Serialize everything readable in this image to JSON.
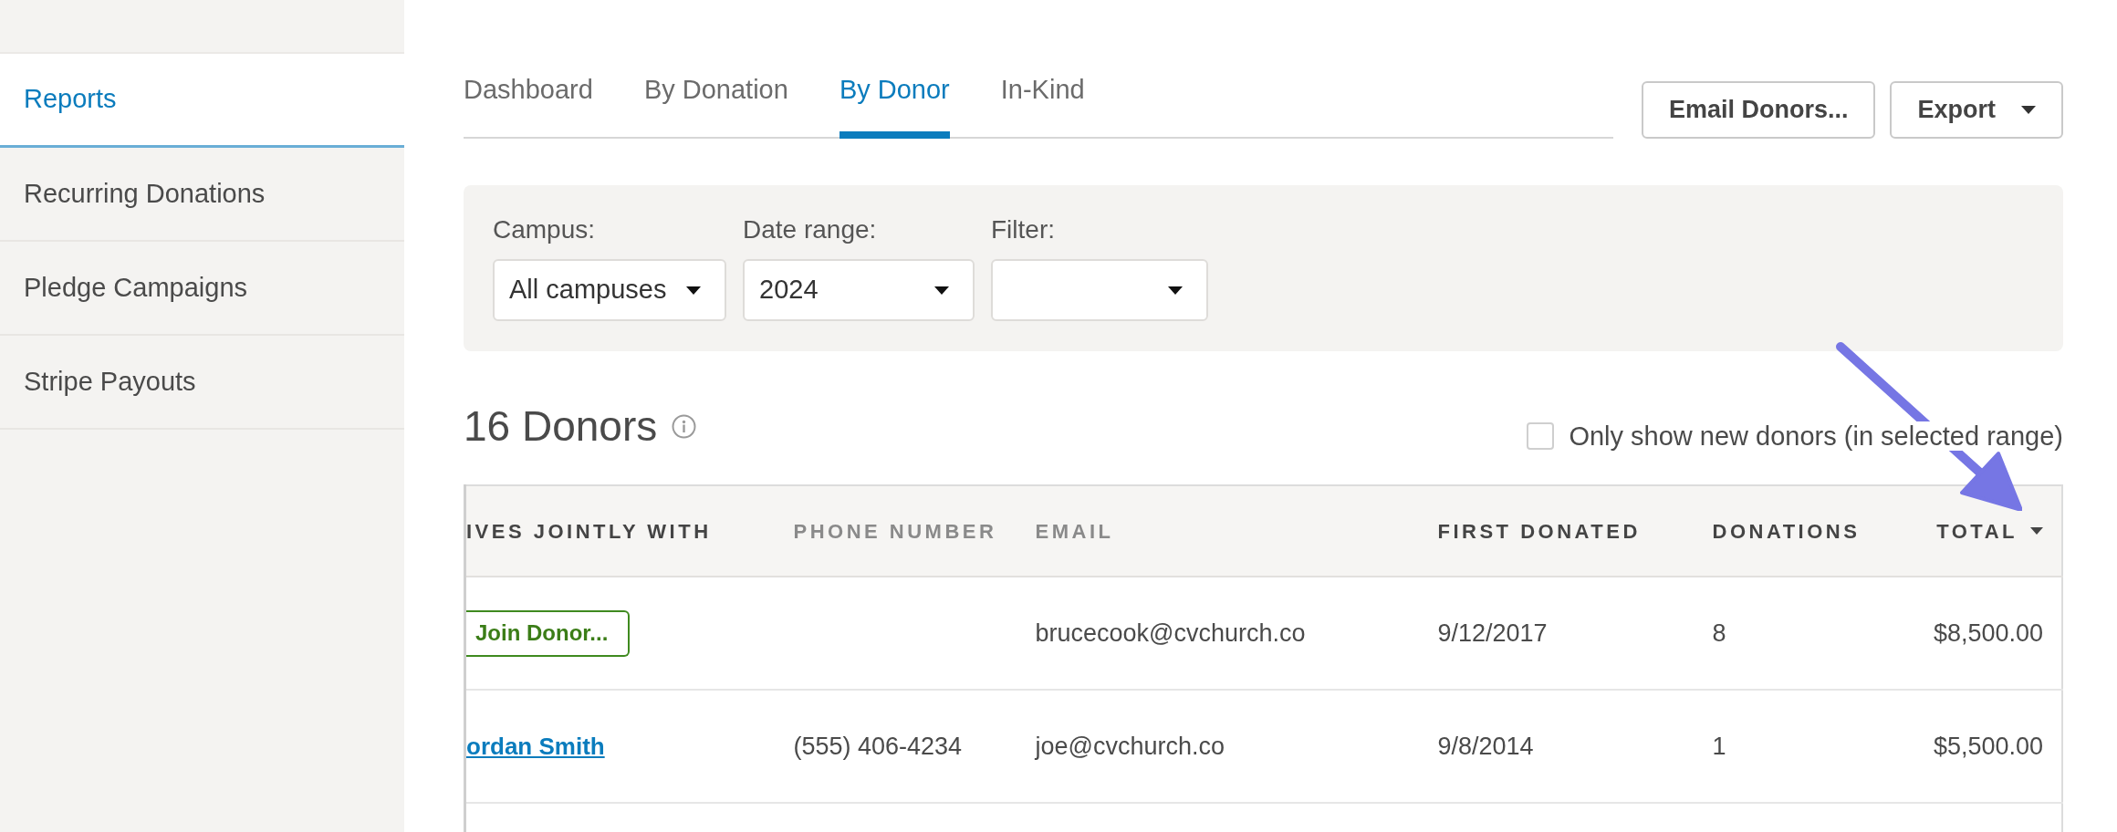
{
  "sidebar": {
    "items": [
      {
        "label": "Reports",
        "selected": true
      },
      {
        "label": "Recurring Donations",
        "selected": false
      },
      {
        "label": "Pledge Campaigns",
        "selected": false
      },
      {
        "label": "Stripe Payouts",
        "selected": false
      }
    ]
  },
  "tabs": [
    {
      "label": "Dashboard",
      "selected": false
    },
    {
      "label": "By Donation",
      "selected": false
    },
    {
      "label": "By Donor",
      "selected": true
    },
    {
      "label": "In-Kind",
      "selected": false
    }
  ],
  "email_button": {
    "label": "Email Donors..."
  },
  "export_button": {
    "label": "Export"
  },
  "filters": [
    {
      "label": "Campus:",
      "value": "All campuses"
    },
    {
      "label": "Date range:",
      "value": "2024"
    },
    {
      "label": "Filter:"
    }
  ],
  "heading": {
    "title": "16 Donors"
  },
  "new_donors_checkbox": {
    "label": "Only show new donors (in selected range)",
    "checked": false
  },
  "table": {
    "columns": [
      {
        "label": "IVES JOINTLY WITH",
        "sortable": true,
        "sorted": false
      },
      {
        "label": "PHONE NUMBER",
        "sortable": false,
        "sorted": false
      },
      {
        "label": "EMAIL",
        "sortable": false,
        "sorted": false
      },
      {
        "label": "FIRST DONATED",
        "sortable": true,
        "sorted": false
      },
      {
        "label": "DONATIONS",
        "sortable": true,
        "sorted": false
      },
      {
        "label": "TOTAL",
        "sortable": true,
        "sorted": true
      }
    ],
    "rows": [
      {
        "cells": [
          {
            "kind": "button",
            "text": "Join Donor..."
          },
          {
            "kind": "empty"
          },
          {
            "kind": "text",
            "text": "brucecook@cvchurch.co"
          },
          {
            "kind": "text",
            "text": "9/12/2017"
          },
          {
            "kind": "text",
            "text": "8"
          },
          {
            "kind": "text",
            "text": "$8,500.00"
          }
        ]
      },
      {
        "cells": [
          {
            "kind": "link",
            "text": "ordan Smith"
          },
          {
            "kind": "text",
            "text": "(555) 406-4234"
          },
          {
            "kind": "text",
            "text": "joe@cvchurch.co"
          },
          {
            "kind": "text",
            "text": "9/8/2014"
          },
          {
            "kind": "text",
            "text": "1"
          },
          {
            "kind": "text",
            "text": "$5,500.00"
          }
        ]
      }
    ]
  }
}
